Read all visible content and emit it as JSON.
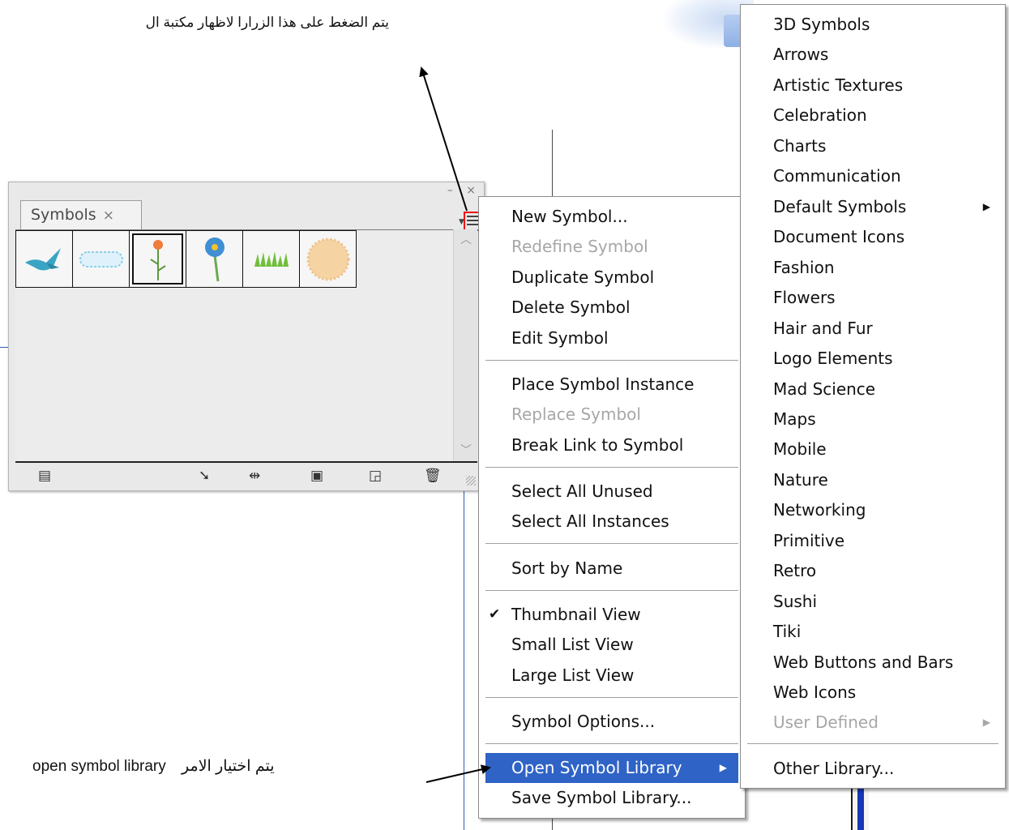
{
  "annotations": {
    "top_text": "يتم الضغط على هذا الزرارا لاظهار مكتبة ال",
    "bottom_text_ar": "يتم اختيار الامر",
    "bottom_text_en": "open symbol library"
  },
  "panel": {
    "tab_label": "Symbols",
    "tab_close": "×",
    "window_controls": "– ×",
    "thumbnails": [
      {
        "name": "bird",
        "selected": false
      },
      {
        "name": "cloud-banner",
        "selected": false
      },
      {
        "name": "orange-flower",
        "selected": true
      },
      {
        "name": "blue-flower",
        "selected": false
      },
      {
        "name": "grass",
        "selected": false
      },
      {
        "name": "fuzzy-circle",
        "selected": false
      }
    ],
    "bottom_icons": [
      "library-menu-icon",
      "place-instance-icon",
      "break-link-icon",
      "symbol-options-icon",
      "new-symbol-icon",
      "delete-icon"
    ]
  },
  "main_menu": {
    "items": [
      {
        "label": "New Symbol...",
        "disabled": false
      },
      {
        "label": "Redefine Symbol",
        "disabled": true
      },
      {
        "label": "Duplicate Symbol",
        "disabled": false
      },
      {
        "label": "Delete Symbol",
        "disabled": false
      },
      {
        "label": "Edit Symbol",
        "disabled": false
      },
      {
        "label": "Place Symbol Instance",
        "disabled": false
      },
      {
        "label": "Replace Symbol",
        "disabled": true
      },
      {
        "label": "Break Link to Symbol",
        "disabled": false
      },
      {
        "label": "Select All Unused",
        "disabled": false
      },
      {
        "label": "Select All Instances",
        "disabled": false
      },
      {
        "label": "Sort by Name",
        "disabled": false
      },
      {
        "label": "Thumbnail View",
        "disabled": false,
        "checked": true
      },
      {
        "label": "Small List View",
        "disabled": false
      },
      {
        "label": "Large List View",
        "disabled": false
      },
      {
        "label": "Symbol Options...",
        "disabled": false
      },
      {
        "label": "Open Symbol Library",
        "disabled": false,
        "active": true,
        "submenu": true
      },
      {
        "label": "Save Symbol Library...",
        "disabled": false
      }
    ]
  },
  "sub_menu": {
    "items": [
      {
        "label": "3D Symbols"
      },
      {
        "label": "Arrows"
      },
      {
        "label": "Artistic Textures"
      },
      {
        "label": "Celebration"
      },
      {
        "label": "Charts"
      },
      {
        "label": "Communication"
      },
      {
        "label": "Default Symbols",
        "submenu": true
      },
      {
        "label": "Document Icons"
      },
      {
        "label": "Fashion"
      },
      {
        "label": "Flowers"
      },
      {
        "label": "Hair and Fur"
      },
      {
        "label": "Logo Elements"
      },
      {
        "label": "Mad Science"
      },
      {
        "label": "Maps"
      },
      {
        "label": "Mobile"
      },
      {
        "label": "Nature"
      },
      {
        "label": "Networking"
      },
      {
        "label": "Primitive"
      },
      {
        "label": "Retro"
      },
      {
        "label": "Sushi"
      },
      {
        "label": "Tiki"
      },
      {
        "label": "Web Buttons and Bars"
      },
      {
        "label": "Web Icons"
      },
      {
        "label": "User Defined",
        "disabled": true,
        "submenu": true
      },
      {
        "label": "Other Library..."
      }
    ]
  },
  "colors": {
    "highlight": "#2f63c6",
    "disabled_text": "#a7a7a7",
    "menu_button_outline": "#e11111"
  }
}
